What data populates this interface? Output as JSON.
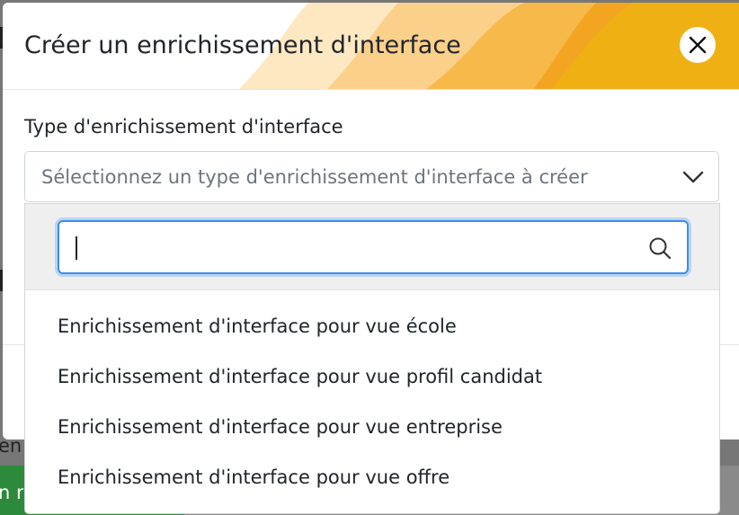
{
  "modal": {
    "title": "Créer un enrichissement d'interface",
    "close_icon": "close-icon",
    "field_label": "Type d'enrichissement d'interface",
    "select_placeholder": "Sélectionnez un type d'enrichissement d'interface à créer",
    "search_value": "",
    "options": [
      "Enrichissement d'interface pour vue école",
      "Enrichissement d'interface pour vue profil candidat",
      "Enrichissement d'interface pour vue entreprise",
      "Enrichissement d'interface pour vue offre"
    ]
  },
  "background": {
    "partial_text_1": "enr",
    "partial_text_2": "n m"
  },
  "colors": {
    "accent_blue": "#3b8eed",
    "header_orange": "#f3a521",
    "header_yellow": "#f7b733",
    "bg_green": "#2d8a3a"
  }
}
